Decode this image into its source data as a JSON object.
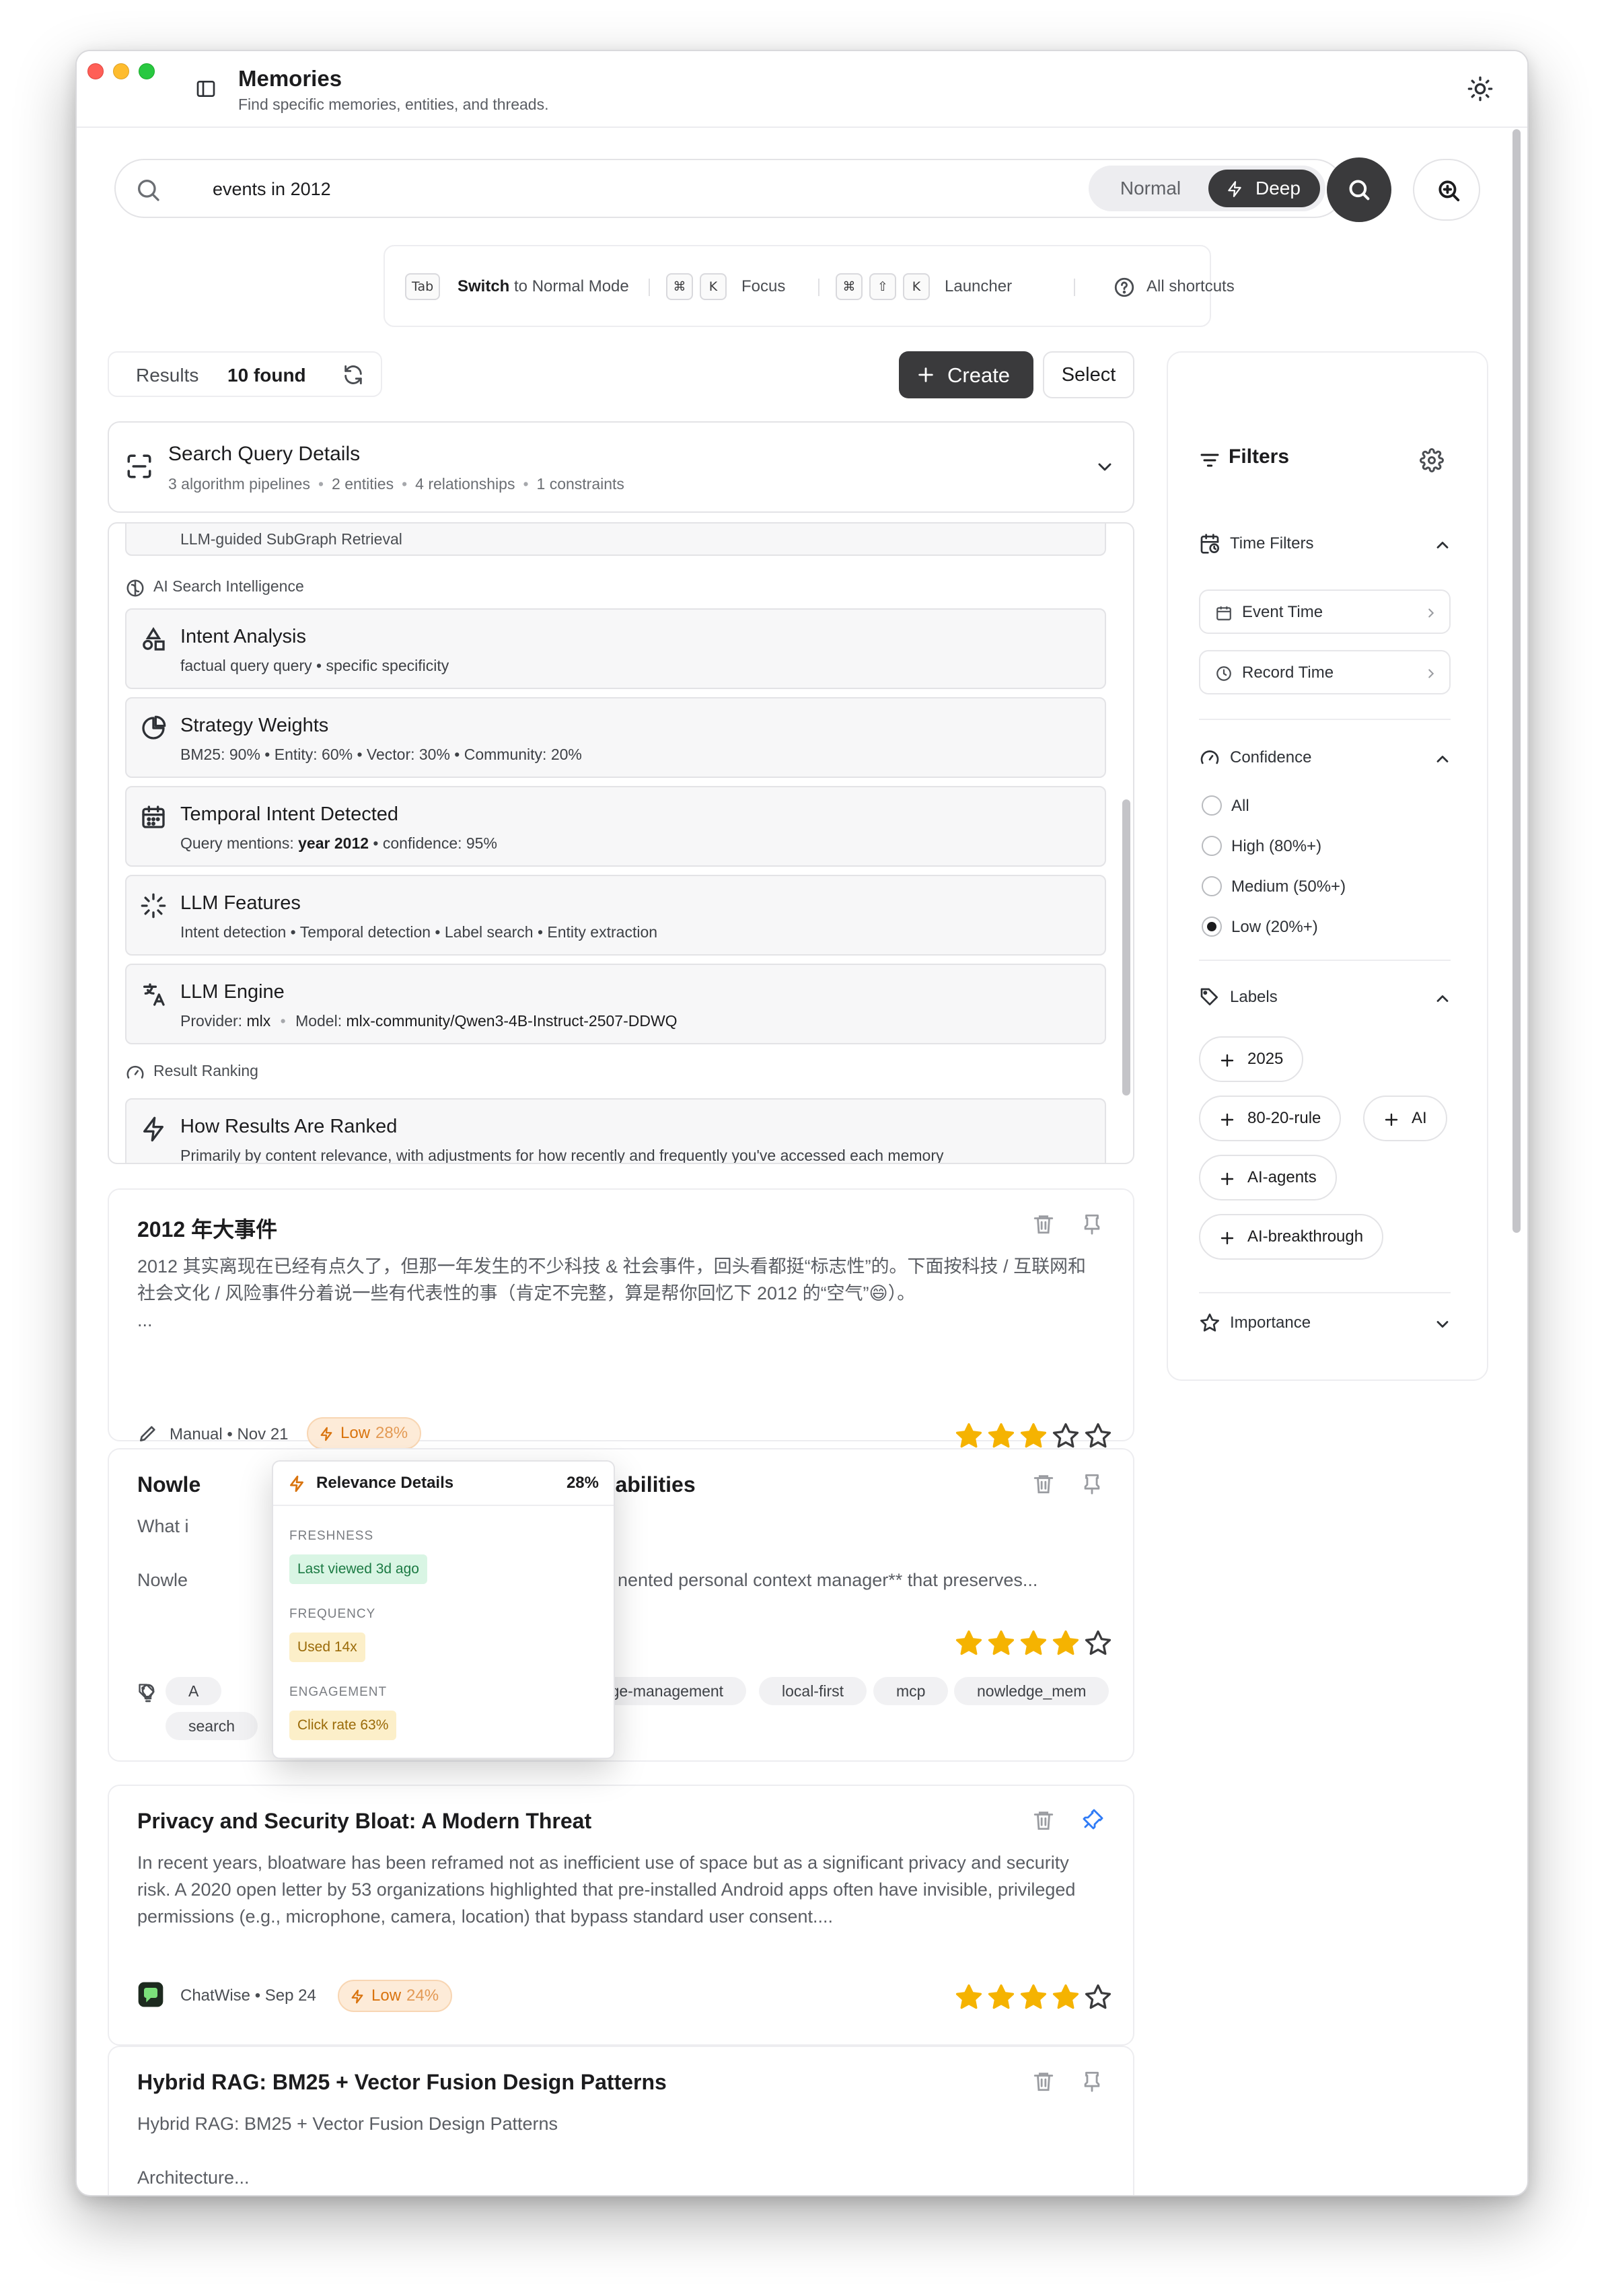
{
  "app": {
    "title": "Memories",
    "subtitle": "Find specific memories, entities, and threads."
  },
  "search": {
    "value": "events in 2012",
    "mode_normal": "Normal",
    "mode_deep": "Deep",
    "active_mode": "Deep"
  },
  "shortcuts": {
    "tab_key": "Tab",
    "switch_bold": "Switch",
    "switch_rest": "to Normal Mode",
    "cmd_key": "⌘",
    "k_key": "K",
    "shift_key": "⇧",
    "focus": "Focus",
    "launcher": "Launcher",
    "all_shortcuts": "All shortcuts"
  },
  "results": {
    "label": "Results",
    "count": "10 found",
    "create": "Create",
    "select": "Select"
  },
  "query_details": {
    "title": "Search Query Details",
    "pipelines": "3 algorithm pipelines",
    "entities": "2 entities",
    "relationships": "4 relationships",
    "constraints": "1 constraints"
  },
  "intelligence": {
    "partial_item": "LLM-guided SubGraph Retrieval",
    "section_ai": "AI Search Intelligence",
    "items": [
      {
        "icon": "shapes-icon",
        "title": "Intent Analysis",
        "desc": "factual query query • specific specificity"
      },
      {
        "icon": "pie-chart-icon",
        "title": "Strategy Weights",
        "desc": "BM25: 90% • Entity: 60% • Vector: 30% • Community: 20%"
      },
      {
        "icon": "calendar-icon",
        "title": "Temporal Intent Detected",
        "desc_pre": "Query mentions: ",
        "desc_bold": "year 2012",
        "desc_post": " • confidence: 95%"
      },
      {
        "icon": "loader-icon",
        "title": "LLM Features",
        "desc": "Intent detection • Temporal detection • Label search • Entity extraction"
      },
      {
        "icon": "translate-icon",
        "title": "LLM Engine",
        "desc_pre": "Provider: ",
        "desc_mid": "mlx",
        "desc_sep": " • ",
        "desc_model_label": "Model: ",
        "desc_model": "mlx-community/Qwen3-4B-Instruct-2507-DDWQ"
      }
    ],
    "section_ranking": "Result Ranking",
    "ranking": {
      "icon": "zap-icon",
      "title": "How Results Are Ranked",
      "desc": "Primarily by content relevance, with adjustments for how recently and frequently you've accessed each memory"
    }
  },
  "memories": [
    {
      "title": "2012 年大事件",
      "body": "2012 其实离现在已经有点久了，但那一年发生的不少科技 & 社会事件，回头看都挺“标志性”的。下面按科技 / 互联网和社会文化 / 风险事件分着说一些有代表性的事（肯定不完整，算是帮你回忆下 2012 的“空气”😄）。",
      "ellipsis": "...",
      "source": "Manual",
      "date": "Nov 21",
      "relevance": "Low",
      "relevance_pct": "28%",
      "stars": 3
    },
    {
      "title_left": "Nowle",
      "title_right": "Capabilities",
      "line1": "What i",
      "line2_left": "Nowle",
      "line2_right": "nented personal context manager** that preserves...",
      "source": "mcp",
      "stars": 4,
      "tags": [
        "A",
        "edge-management",
        "local-first",
        "mcp",
        "nowledge_mem",
        "search"
      ]
    },
    {
      "title": "Privacy and Security Bloat: A Modern Threat",
      "body": "In recent years, bloatware has been reframed not as inefficient use of space but as a significant privacy and security risk. A 2020 open letter by 53 organizations highlighted that pre-installed Android apps often have invisible, privileged permissions (e.g., microphone, camera, location) that bypass standard user consent....",
      "source": "ChatWise",
      "date": "Sep 24",
      "relevance": "Low",
      "relevance_pct": "24%",
      "stars": 4,
      "pinned": true
    },
    {
      "title": "Hybrid RAG: BM25 + Vector Fusion Design Patterns",
      "line1": "Hybrid RAG: BM25 + Vector Fusion Design Patterns",
      "line2": "Architecture..."
    }
  ],
  "relevance_popover": {
    "title": "Relevance Details",
    "pct": "28%",
    "freshness_label": "FRESHNESS",
    "freshness": "Last viewed 3d ago",
    "frequency_label": "FREQUENCY",
    "frequency": "Used 14x",
    "engagement_label": "ENGAGEMENT",
    "engagement": "Click rate 63%"
  },
  "filters": {
    "title": "Filters",
    "time_filters": "Time Filters",
    "event_time": "Event Time",
    "record_time": "Record Time",
    "confidence": "Confidence",
    "conf_options": [
      "All",
      "High (80%+)",
      "Medium (50%+)",
      "Low (20%+)"
    ],
    "conf_selected": "Low (20%+)",
    "labels": "Labels",
    "label_items": [
      "2025",
      "80-20-rule",
      "AI",
      "AI-agents",
      "AI-breakthrough"
    ],
    "importance": "Importance"
  },
  "colors": {
    "accent_dark": "#3a3a3c",
    "star": "#f5b301",
    "low_badge": "#d9740f",
    "pin_active": "#2f7bf6"
  }
}
